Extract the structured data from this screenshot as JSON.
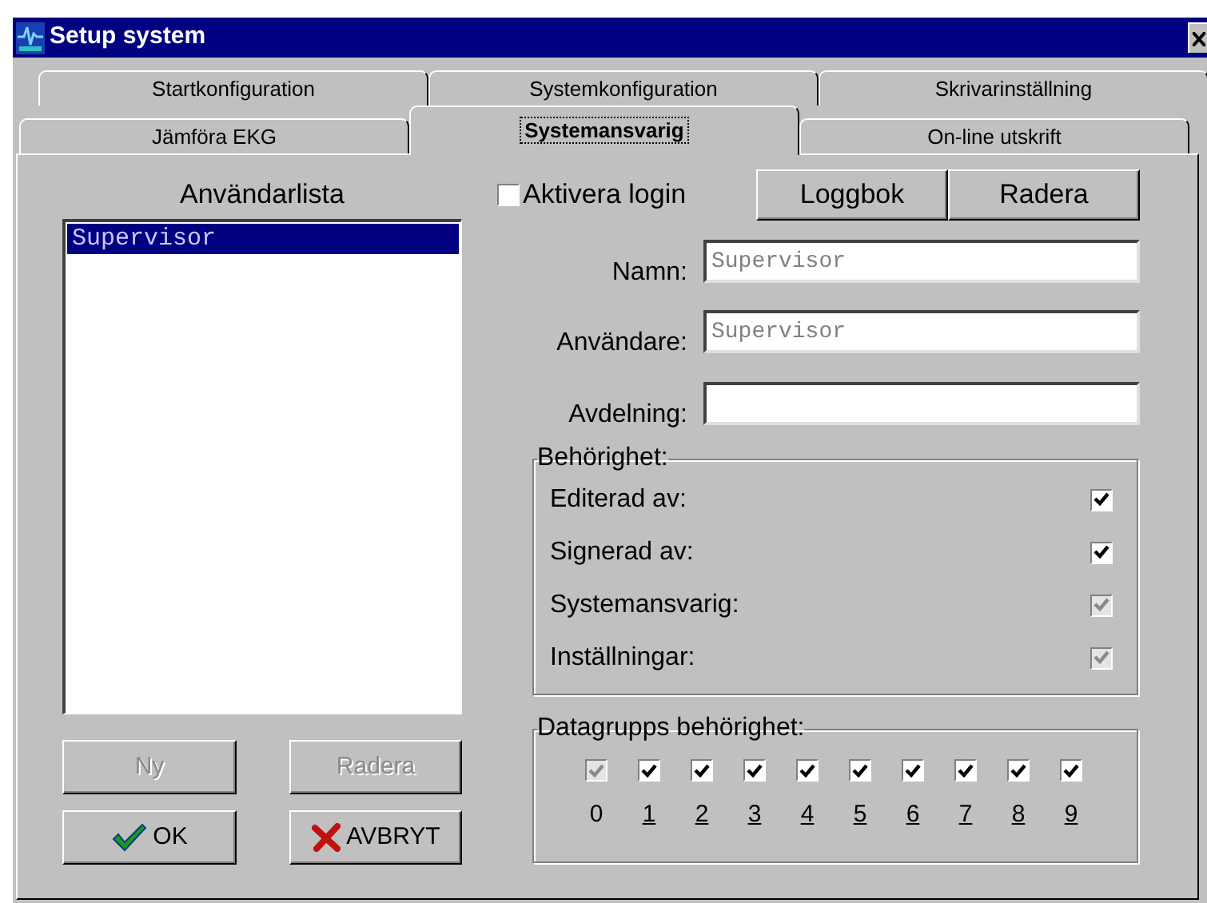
{
  "window": {
    "title": "Setup system"
  },
  "tab_rows": [
    [
      {
        "label": "Startkonfiguration",
        "selected": false
      },
      {
        "label": "Systemkonfiguration",
        "selected": false
      },
      {
        "label": "Skrivarinställning",
        "selected": false
      }
    ],
    [
      {
        "label": "Jämföra EKG",
        "selected": false
      },
      {
        "label": "Systemansvarig",
        "selected": true
      },
      {
        "label": "On-line utskrift",
        "selected": false
      }
    ]
  ],
  "user_list": {
    "title": "Användarlista",
    "items": [
      {
        "label": "Supervisor",
        "selected": true
      }
    ]
  },
  "list_buttons": [
    {
      "label": "Ny",
      "kind": "plain",
      "disabled": true
    },
    {
      "label": "Radera",
      "kind": "plain",
      "disabled": true
    },
    {
      "label": "OK",
      "kind": "ok",
      "disabled": false
    },
    {
      "label": "AVBRYT",
      "kind": "cancel",
      "disabled": false
    }
  ],
  "login": {
    "label": "Aktivera login",
    "checked": false
  },
  "top_buttons": [
    "Loggbok",
    "Radera"
  ],
  "fields": [
    {
      "label": "Namn:",
      "value": "Supervisor"
    },
    {
      "label": "Användare:",
      "value": "Supervisor"
    },
    {
      "label": "Avdelning:"
    }
  ],
  "permissions": {
    "title": "Behörighet:",
    "items": [
      {
        "label": "Editerad av:",
        "checked": true,
        "disabled": false
      },
      {
        "label": "Signerad av:",
        "checked": true,
        "disabled": false
      },
      {
        "label": "Systemansvarig:",
        "checked": true,
        "disabled": true
      },
      {
        "label": "Inställningar:",
        "checked": true,
        "disabled": true
      }
    ]
  },
  "data_groups": {
    "title": "Datagrupps behörighet:",
    "items": [
      {
        "label": "0",
        "checked": true,
        "disabled": true,
        "underlined": false
      },
      {
        "label": "1",
        "checked": true,
        "disabled": false,
        "underlined": true
      },
      {
        "label": "2",
        "checked": true,
        "disabled": false,
        "underlined": true
      },
      {
        "label": "3",
        "checked": true,
        "disabled": false,
        "underlined": true
      },
      {
        "label": "4",
        "checked": true,
        "disabled": false,
        "underlined": true
      },
      {
        "label": "5",
        "checked": true,
        "disabled": false,
        "underlined": true
      },
      {
        "label": "6",
        "checked": true,
        "disabled": false,
        "underlined": true
      },
      {
        "label": "7",
        "checked": true,
        "disabled": false,
        "underlined": true
      },
      {
        "label": "8",
        "checked": true,
        "disabled": false,
        "underlined": true
      },
      {
        "label": "9",
        "checked": true,
        "disabled": false,
        "underlined": true
      }
    ]
  }
}
